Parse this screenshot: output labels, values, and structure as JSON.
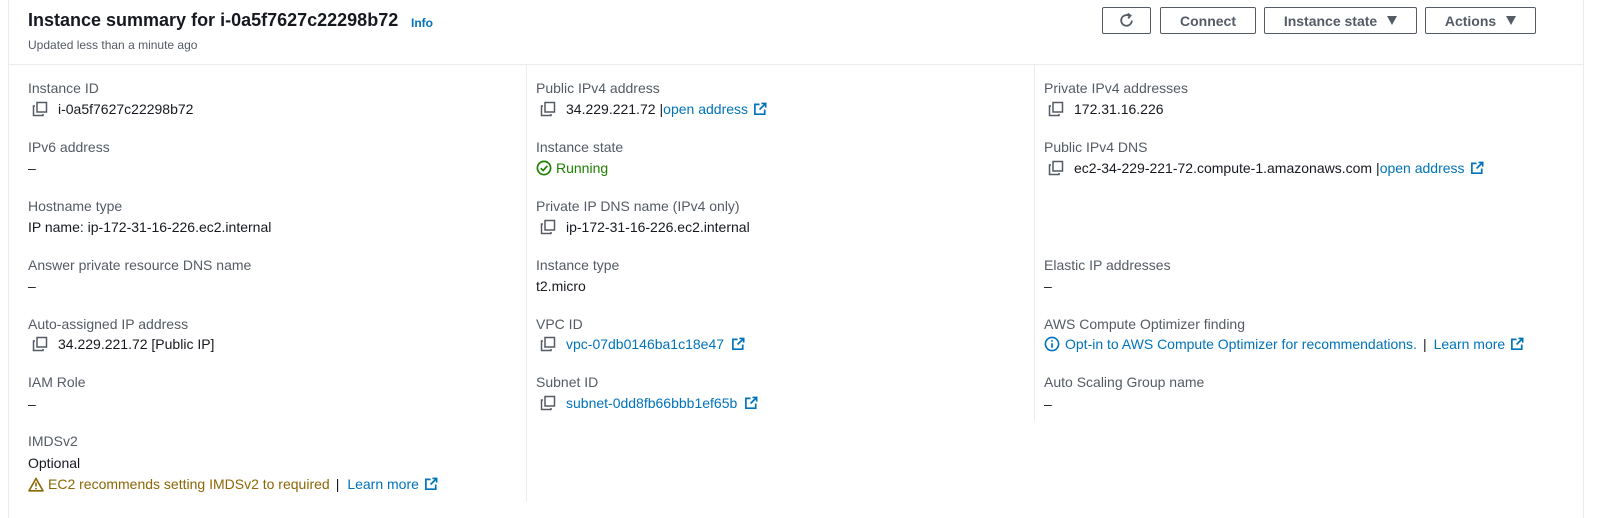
{
  "header": {
    "title": "Instance summary for i-0a5f7627c22298b72",
    "info": "Info",
    "updated": "Updated less than a minute ago",
    "buttons": {
      "connect": "Connect",
      "instance_state": "Instance state",
      "actions": "Actions"
    }
  },
  "col1": {
    "instance_id_label": "Instance ID",
    "instance_id": "i-0a5f7627c22298b72",
    "ipv6_label": "IPv6 address",
    "ipv6": "–",
    "hostname_type_label": "Hostname type",
    "hostname_type": "IP name: ip-172-31-16-226.ec2.internal",
    "answer_dns_label": "Answer private resource DNS name",
    "answer_dns": "–",
    "auto_ip_label": "Auto-assigned IP address",
    "auto_ip": "34.229.221.72 [Public IP]",
    "iam_label": "IAM Role",
    "iam": "–",
    "imds_label": "IMDSv2",
    "imds": "Optional",
    "imds_warning": "EC2 recommends setting IMDSv2 to required",
    "imds_sep": "|",
    "imds_learn": "Learn more"
  },
  "col2": {
    "public_ipv4_label": "Public IPv4 address",
    "public_ipv4": "34.229.221.72",
    "public_ipv4_sep": "|",
    "public_ipv4_open": "open address",
    "state_label": "Instance state",
    "state": "Running",
    "private_dns_label": "Private IP DNS name (IPv4 only)",
    "private_dns": "ip-172-31-16-226.ec2.internal",
    "type_label": "Instance type",
    "type": "t2.micro",
    "vpc_label": "VPC ID",
    "vpc": "vpc-07db0146ba1c18e47",
    "subnet_label": "Subnet ID",
    "subnet": "subnet-0dd8fb66bbb1ef65b"
  },
  "col3": {
    "private_ipv4_label": "Private IPv4 addresses",
    "private_ipv4": "172.31.16.226",
    "public_dns_label": "Public IPv4 DNS",
    "public_dns": "ec2-34-229-221-72.compute-1.amazonaws.com",
    "public_dns_sep": "|",
    "public_dns_open": "open address",
    "elastic_label": "Elastic IP addresses",
    "elastic": "–",
    "optimizer_label": "AWS Compute Optimizer finding",
    "optimizer_link": "Opt-in to AWS Compute Optimizer for recommendations.",
    "optimizer_sep": "|",
    "optimizer_learn": "Learn more",
    "asg_label": "Auto Scaling Group name",
    "asg": "–"
  },
  "colors": {
    "link": "#0073bb",
    "success": "#1d8102",
    "warning": "#8d6605",
    "label": "#545b64",
    "divider": "#eaeded"
  },
  "icons": [
    "refresh-icon",
    "caret-down-icon",
    "copy-icon",
    "external-link-icon",
    "status-success-icon",
    "warning-icon",
    "info-circle-icon"
  ]
}
